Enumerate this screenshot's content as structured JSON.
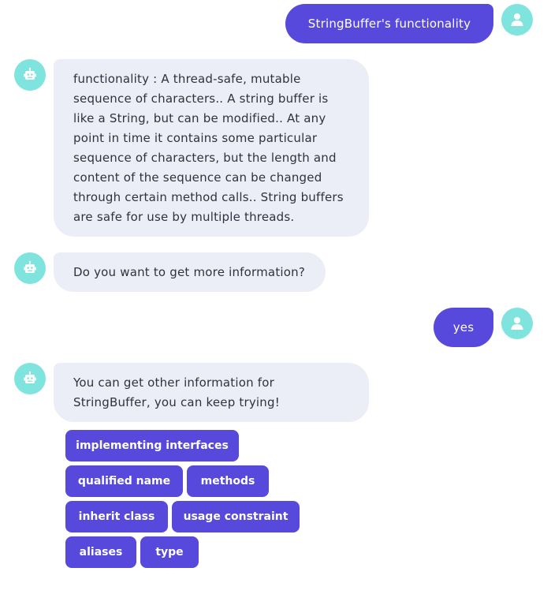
{
  "messages": {
    "user_1": "StringBuffer's functionality",
    "bot_1": "functionality : A thread-safe, mutable sequence of characters.. A string buffer is like a String, but can be modified.. At any point in time it contains some particular sequence of characters, but the length and content of the sequence can be changed through certain method calls.. String buffers are safe for use by multiple threads.",
    "bot_2": "Do you want to get more information?",
    "user_2": "yes",
    "bot_3": "You can get other information for StringBuffer, you can keep trying!"
  },
  "quick_replies": [
    "implementing interfaces",
    "qualified name",
    "methods",
    "inherit class",
    "usage constraint",
    "aliases",
    "type"
  ],
  "colors": {
    "accent": "#5649dc",
    "avatar": "#7fe3de",
    "bot_bubble": "#eceef7",
    "bot_text": "#2f3140"
  },
  "icons": {
    "user": "user-icon",
    "bot": "robot-icon"
  }
}
